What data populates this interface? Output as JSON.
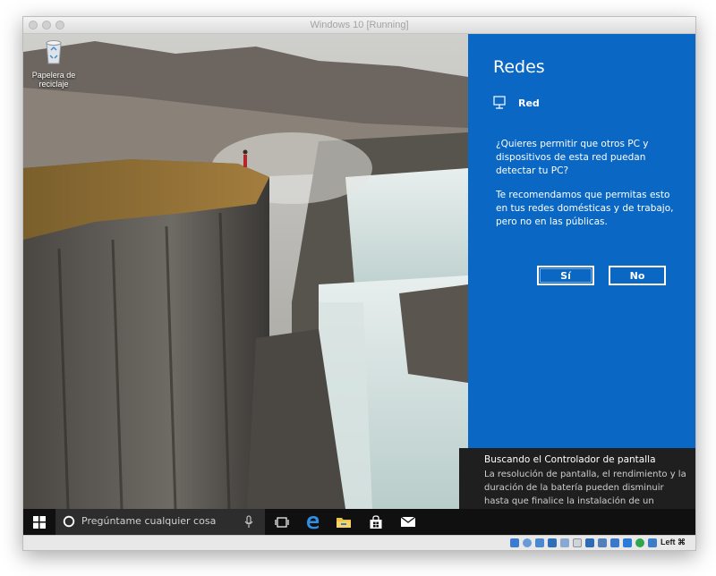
{
  "window": {
    "title": "Windows 10 [Running]"
  },
  "desktop": {
    "recycle_bin_label": "Papelera de reciclaje",
    "recycle_bin_icon": "recycle-bin-icon"
  },
  "network_panel": {
    "title": "Redes",
    "network_icon": "network-monitor-icon",
    "network_name": "Red",
    "question": "¿Quieres permitir que otros PC y dispositivos de esta red puedan detectar tu PC?",
    "recommendation": "Te recomendamos que permitas esto en tus redes domésticas y de trabajo, pero no en las públicas.",
    "yes_label": "Sí",
    "no_label": "No",
    "accent_color": "#0a67c3"
  },
  "notification": {
    "title": "Buscando el Controlador de pantalla",
    "body": "La resolución de pantalla, el rendimiento y la duración de la batería pueden disminuir hasta que finalice la instalación de un"
  },
  "taskbar": {
    "start_icon": "windows-logo-icon",
    "cortana_icon": "cortana-circle-icon",
    "search_placeholder": "Pregúntame cualquier cosa",
    "mic_icon": "microphone-icon",
    "task_view_icon": "task-view-icon",
    "edge_icon": "edge-browser-icon",
    "explorer_icon": "file-explorer-icon",
    "store_icon": "store-bag-icon",
    "mail_icon": "mail-envelope-icon"
  },
  "vm_statusbar": {
    "host_key_label": "Left ⌘"
  }
}
